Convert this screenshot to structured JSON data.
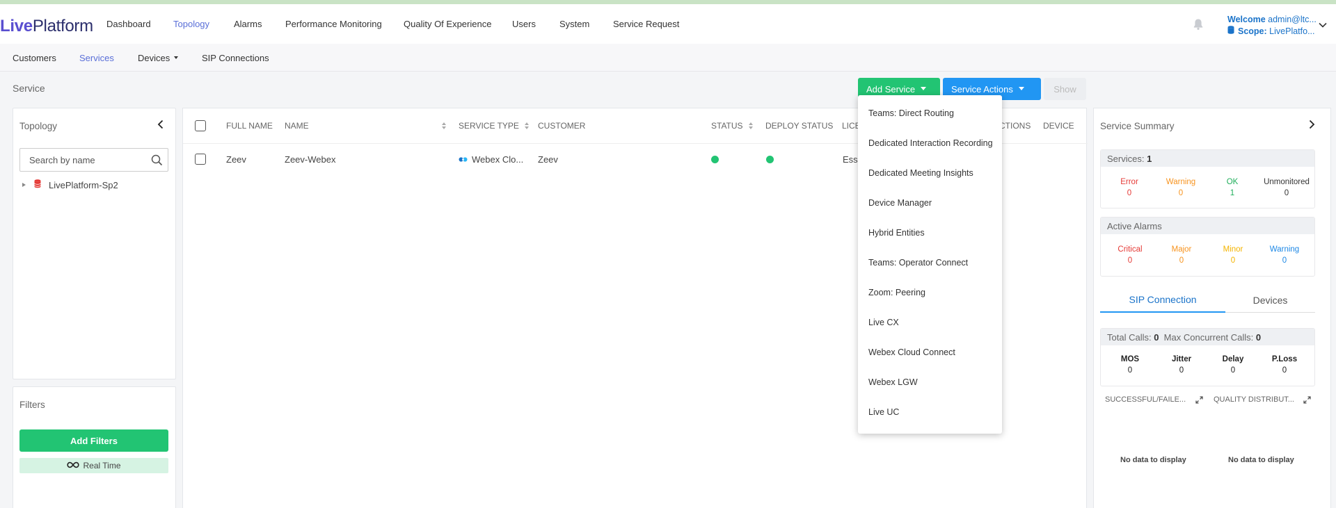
{
  "app": {
    "logo_part1": "Live",
    "logo_part2": "Platform"
  },
  "main_nav": {
    "items": [
      "Dashboard",
      "Topology",
      "Alarms",
      "Performance Monitoring",
      "Quality Of Experience",
      "Users",
      "System",
      "Service Request"
    ],
    "active": "Topology"
  },
  "user": {
    "welcome_label": "Welcome",
    "username": "admin@ltc...",
    "scope_label": "Scope:",
    "scope_value": "LivePlatfo..."
  },
  "sub_nav": {
    "items": [
      "Customers",
      "Services",
      "Devices",
      "SIP Connections"
    ],
    "active": "Services"
  },
  "page": {
    "title": "Service"
  },
  "toolbar": {
    "add_service": "Add Service",
    "service_actions": "Service Actions",
    "show": "Show"
  },
  "topology_panel": {
    "title": "Topology",
    "search_placeholder": "Search by name",
    "tree_node": "LivePlatform-Sp2"
  },
  "filters_panel": {
    "title": "Filters",
    "add_filters": "Add Filters",
    "real_time": "Real Time"
  },
  "table": {
    "columns": [
      "FULL NAME",
      "NAME",
      "SERVICE TYPE",
      "CUSTOMER",
      "STATUS",
      "DEPLOY STATUS",
      "LICE",
      "ECTIONS",
      "DEVICE"
    ],
    "rows": [
      {
        "full_name": "Zeev",
        "name": "Zeev-Webex",
        "service_type": "Webex Clo...",
        "customer": "Zeev",
        "status": "ok",
        "deploy_status": "ok",
        "license": "Esse"
      }
    ]
  },
  "add_service_menu": {
    "items": [
      "Teams: Direct Routing",
      "Dedicated Interaction Recording",
      "Dedicated Meeting Insights",
      "Device Manager",
      "Hybrid Entities",
      "Teams: Operator Connect",
      "Zoom: Peering",
      "Live CX",
      "Webex Cloud Connect",
      "Webex LGW",
      "Live UC"
    ]
  },
  "summary": {
    "title": "Service Summary",
    "services_label": "Services:",
    "services_count": "1",
    "service_stats": [
      {
        "label": "Error",
        "value": "0",
        "color": "#e53935"
      },
      {
        "label": "Warning",
        "value": "0",
        "color": "#f7931e"
      },
      {
        "label": "OK",
        "value": "1",
        "color": "#1fae5b"
      },
      {
        "label": "Unmonitored",
        "value": "0",
        "color": "#333333"
      }
    ],
    "alarms_title": "Active Alarms",
    "alarm_stats": [
      {
        "label": "Critical",
        "value": "0",
        "color": "#e53935"
      },
      {
        "label": "Major",
        "value": "0",
        "color": "#f7931e"
      },
      {
        "label": "Minor",
        "value": "0",
        "color": "#f4b400"
      },
      {
        "label": "Warning",
        "value": "0",
        "color": "#1e88e5"
      }
    ],
    "tabs": [
      "SIP Connection",
      "Devices"
    ],
    "total_calls_label": "Total Calls:",
    "total_calls": "0",
    "max_calls_label": "Max Concurrent Calls:",
    "max_calls": "0",
    "quality_stats": [
      {
        "label": "MOS",
        "value": "0"
      },
      {
        "label": "Jitter",
        "value": "0"
      },
      {
        "label": "Delay",
        "value": "0"
      },
      {
        "label": "P.Loss",
        "value": "0"
      }
    ],
    "graph1_title": "SUCCESSFUL/FAILE...",
    "graph2_title": "QUALITY DISTRIBUT...",
    "no_data": "No data to display"
  },
  "colors": {
    "accent": "#5a4fd0",
    "green": "#22c473",
    "blue": "#2196f3"
  }
}
